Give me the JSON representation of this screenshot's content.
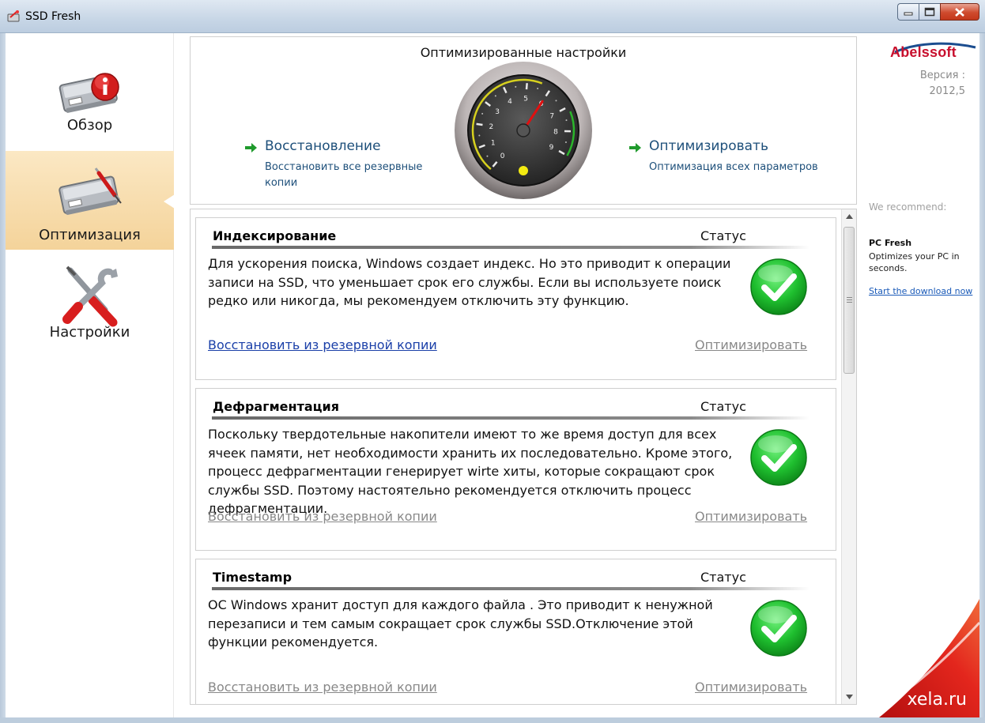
{
  "window": {
    "title": "SSD Fresh",
    "buttons": {
      "minimize": "minimize",
      "maximize": "maximize",
      "close": "close"
    }
  },
  "sidebar": {
    "items": [
      {
        "label": "Обзор",
        "icon": "ssd-info-icon",
        "selected": false
      },
      {
        "label": "Оптимизация",
        "icon": "ssd-optimize-icon",
        "selected": true
      },
      {
        "label": "Настройки",
        "icon": "tools-icon",
        "selected": false
      }
    ]
  },
  "top": {
    "title": "Оптимизированные настройки",
    "restore": {
      "title": "Восстановление",
      "desc_line1": "Восстановить все резервные",
      "desc_line2": "копии"
    },
    "optimize": {
      "title": "Оптимизировать",
      "desc": "Оптимизация всех параметров"
    },
    "gauge": {
      "ticks": [
        "0",
        "1",
        "2",
        "3",
        "4",
        "5",
        "6",
        "7",
        "8",
        "9"
      ],
      "needle_value": 6
    }
  },
  "brand": {
    "logo": "Abelssoft",
    "version_label": "Версия :",
    "version_value": "2012,5"
  },
  "recommend": {
    "label": "We recommend:",
    "product": "PC Fresh",
    "desc": "Optimizes your PC in seconds.",
    "link": "Start the download now"
  },
  "cards": [
    {
      "title": "Индексирование",
      "status_label": "Статус",
      "desc": "Для ускорения поиска, Windows создает индекс. Но это приводит к операции записи на SSD, что уменьшает срок его службы. Если вы используете поиск редко или никогда, мы рекомендуем отключить эту функцию.",
      "restore_link": "Восстановить из резервной копии",
      "optimize_link": "Оптимизировать",
      "status": "ok"
    },
    {
      "title": "Дефрагментация",
      "status_label": "Статус",
      "desc": "Поскольку твердотельные накопители имеют то же время доступ для всех ячеек памяти, нет необходимости хранить их последовательно. Кроме этого, процесс дефрагментации генерирует wirte хиты, которые сокращают срок службы SSD. Поэтому настоятельно рекомендуется отключить процесс дефрагментации.",
      "restore_link": "Восстановить из резервной копии",
      "optimize_link": "Оптимизировать",
      "status": "ok"
    },
    {
      "title": "Timestamp",
      "status_label": "Статус",
      "desc": "ОС Windows хранит доступ для каждого файла . Это приводит к ненужной перезаписи и тем самым сокращает срок службы SSD.Отключение этой функции рекомендуется.",
      "restore_link": "Восстановить из резервной копии",
      "optimize_link": "Оптимизировать",
      "status": "ok"
    }
  ],
  "watermark": "xela.ru",
  "colors": {
    "accent_link": "#1d4f7a",
    "selected_bg": "#f4d39a",
    "status_green": "#1aa62a",
    "brand_red": "#c8102e"
  }
}
